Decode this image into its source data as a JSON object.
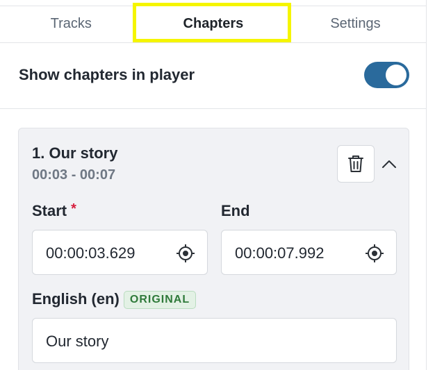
{
  "tabs": [
    {
      "label": "Tracks",
      "active": false
    },
    {
      "label": "Chapters",
      "active": true
    },
    {
      "label": "Settings",
      "active": false
    }
  ],
  "toggle": {
    "label": "Show chapters in player",
    "on": true
  },
  "chapter": {
    "title": "1. Our story",
    "range": "00:03 - 00:07",
    "start_label": "Start",
    "required_mark": "*",
    "start_value": "00:00:03.629",
    "end_label": "End",
    "end_value": "00:00:07.992",
    "language_label": "English (en)",
    "language_badge": "ORIGINAL",
    "title_value": "Our story"
  },
  "icons": {
    "delete": "trash-icon",
    "collapse": "chevron-up-icon",
    "set_time": "crosshair-icon"
  },
  "colors": {
    "toggle_on": "#2a6a9c",
    "highlight": "#f5f500",
    "badge_text": "#2f7a3a"
  }
}
